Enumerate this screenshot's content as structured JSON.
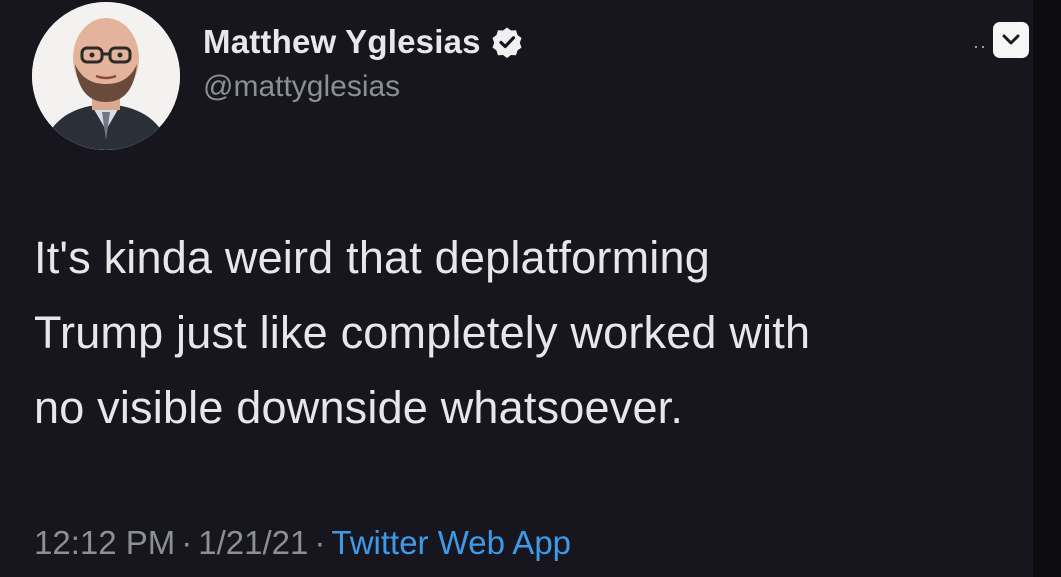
{
  "tweet": {
    "author_name": "Matthew Yglesias",
    "handle": "@mattyglesias",
    "text_lines": [
      "It's kinda weird that deplatforming",
      "Trump just like completely worked with",
      "no visible downside whatsoever."
    ],
    "time": "12:12 PM",
    "date": "1/21/21",
    "separator": "·",
    "source": "Twitter Web App"
  },
  "icons": {
    "verified": "verified-badge-icon",
    "more": "more-options-icon",
    "chevron": "chevron-down-icon"
  },
  "colors": {
    "background": "#17161f",
    "text": "#e6e7e9",
    "secondary": "#8b8f96",
    "link": "#3d9ae8"
  }
}
